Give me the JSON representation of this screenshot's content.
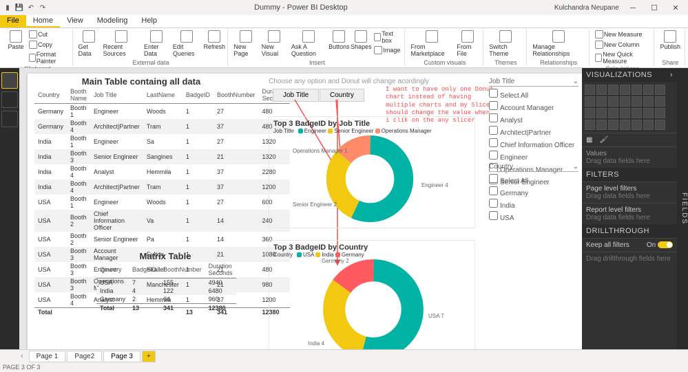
{
  "app": {
    "title": "Dummy - Power BI Desktop",
    "user": "Kulchandra Neupane"
  },
  "ribbonTabs": {
    "file": "File",
    "home": "Home",
    "view": "View",
    "modeling": "Modeling",
    "help": "Help"
  },
  "ribbon": {
    "clipboard": {
      "paste": "Paste",
      "cut": "Cut",
      "copy": "Copy",
      "fp": "Format Painter",
      "group": "Clipboard"
    },
    "external": {
      "get": "Get\nData",
      "recent": "Recent\nSources",
      "enter": "Enter\nData",
      "edit": "Edit\nQueries",
      "refresh": "Refresh",
      "group": "External data"
    },
    "insert": {
      "newpage": "New\nPage",
      "newvis": "New\nVisual",
      "ask": "Ask A\nQuestion",
      "buttons": "Buttons",
      "shapes": "Shapes",
      "textbox": "Text box",
      "image": "Image",
      "market": "From\nMarketplace",
      "file": "From\nFile",
      "group": "Insert",
      "custom": "Custom visuals"
    },
    "themes": {
      "switch": "Switch\nTheme",
      "group": "Themes"
    },
    "rel": {
      "manage": "Manage\nRelationships",
      "group": "Relationships"
    },
    "calc": {
      "nm": "New Measure",
      "nc": "New Column",
      "nqm": "New Quick Measure",
      "group": "Calculations"
    },
    "share": {
      "publish": "Publish",
      "group": "Share"
    }
  },
  "mainTable": {
    "title": "Main Table containg all data",
    "cols": [
      "Country",
      "Booth Name",
      "Job Title",
      "LastName",
      "BadgeID",
      "BoothNumber",
      "Duration Seconds"
    ],
    "rows": [
      [
        "Germany",
        "Booth 1",
        "Engineer",
        "Woods",
        "1",
        "27",
        "480"
      ],
      [
        "Germany",
        "Booth 4",
        "Architect|Partner",
        "Tram",
        "1",
        "37",
        "480"
      ],
      [
        "India",
        "Booth 1",
        "Engineer",
        "Sa",
        "1",
        "27",
        "1320"
      ],
      [
        "India",
        "Booth 3",
        "Senior Engineer",
        "Sangines",
        "1",
        "21",
        "1320"
      ],
      [
        "India",
        "Booth 4",
        "Analyst",
        "Hemmila",
        "1",
        "37",
        "2280"
      ],
      [
        "India",
        "Booth 4",
        "Architect|Partner",
        "Tram",
        "1",
        "37",
        "1200"
      ],
      [
        "USA",
        "Booth 1",
        "Engineer",
        "Woods",
        "1",
        "27",
        "600"
      ],
      [
        "USA",
        "Booth 2",
        "Chief Information Officer",
        "Va",
        "1",
        "14",
        "240"
      ],
      [
        "USA",
        "Booth 2",
        "Senior Engineer",
        "Pa",
        "1",
        "14",
        "360"
      ],
      [
        "USA",
        "Booth 3",
        "Account Manager",
        "Fulton",
        "1",
        "21",
        "1080"
      ],
      [
        "USA",
        "Booth 3",
        "Engineer",
        "Skallet",
        "1",
        "21",
        "480"
      ],
      [
        "USA",
        "Booth 3",
        "Operations Manager",
        "Manchester",
        "1",
        "21",
        "980"
      ],
      [
        "USA",
        "Booth 4",
        "Analyst",
        "Hemmila",
        "1",
        "37",
        "1200"
      ]
    ],
    "total": [
      "Total",
      "",
      "",
      "",
      "13",
      "341",
      "12380"
    ]
  },
  "matrixTable": {
    "title": "Matrix Table",
    "cols": [
      "Country",
      "BadgeID",
      "BoothNumber",
      "Duration Seconds"
    ],
    "rows": [
      [
        "USA",
        "7",
        "155",
        "4940"
      ],
      [
        "India",
        "4",
        "122",
        "6480"
      ],
      [
        "Germany",
        "2",
        "64",
        "960"
      ]
    ],
    "total": [
      "Total",
      "13",
      "341",
      "12380"
    ]
  },
  "slicerBtns": {
    "job": "Job Title",
    "country": "Country"
  },
  "hint": "Choose any option and Donut will change acordingly",
  "redNote": "I want to have only one Donut\nchart instead of having\nmultiple charts and my Slicer\nshould change the value when\ni clik on the any slicer",
  "donut1": {
    "title": "Top 3 BadgeID by Job Title",
    "legendLabel": "Job Title",
    "legend": [
      {
        "name": "Engineer",
        "color": "#00b3a4"
      },
      {
        "name": "Senior Engineer",
        "color": "#f2c811"
      },
      {
        "name": "Operations Manager",
        "color": "#ff8b6a"
      }
    ],
    "labels": {
      "a": "Operations Manager 1",
      "b": "Senior Engineer 2",
      "c": "Engineer 4"
    }
  },
  "donut2": {
    "title": "Top 3 BadgeID by Country",
    "legendLabel": "Country",
    "legend": [
      {
        "name": "USA",
        "color": "#00b3a4"
      },
      {
        "name": "India",
        "color": "#f2c811"
      },
      {
        "name": "Germany",
        "color": "#ff5a5f"
      }
    ],
    "labels": {
      "a": "Germany 2",
      "b": "India 4",
      "c": "USA 7"
    }
  },
  "jobSlicer": {
    "title": "Job Title",
    "items": [
      "Select All",
      "Account Manager",
      "Analyst",
      "Architect|Partner",
      "Chief Information Officer",
      "Engineer",
      "Operations Manager",
      "Senior Engineer"
    ]
  },
  "countrySlicer": {
    "title": "Country",
    "items": [
      "Select All",
      "Germany",
      "India",
      "USA"
    ]
  },
  "vizPane": {
    "title": "VISUALIZATIONS",
    "values": "Values",
    "valuesHint": "Drag data fields here",
    "filters": "FILTERS",
    "pageFilters": "Page level filters",
    "pageHint": "Drag data fields here",
    "rptFilters": "Report level filters",
    "rptHint": "Drag data fields here",
    "drill": "DRILLTHROUGH",
    "keep": "Keep all filters",
    "keepState": "On",
    "drillHint": "Drag drillthrough fields here"
  },
  "fieldsTab": "FIELDS",
  "pages": {
    "p1": "Page 1",
    "p2": "Page2",
    "p3": "Page 3"
  },
  "status": "PAGE 3 OF 3",
  "chart_data": [
    {
      "type": "pie",
      "title": "Top 3 BadgeID by Job Title",
      "series": [
        {
          "name": "Engineer",
          "value": 4
        },
        {
          "name": "Senior Engineer",
          "value": 2
        },
        {
          "name": "Operations Manager",
          "value": 1
        }
      ]
    },
    {
      "type": "pie",
      "title": "Top 3 BadgeID by Country",
      "series": [
        {
          "name": "USA",
          "value": 7
        },
        {
          "name": "India",
          "value": 4
        },
        {
          "name": "Germany",
          "value": 2
        }
      ]
    }
  ]
}
